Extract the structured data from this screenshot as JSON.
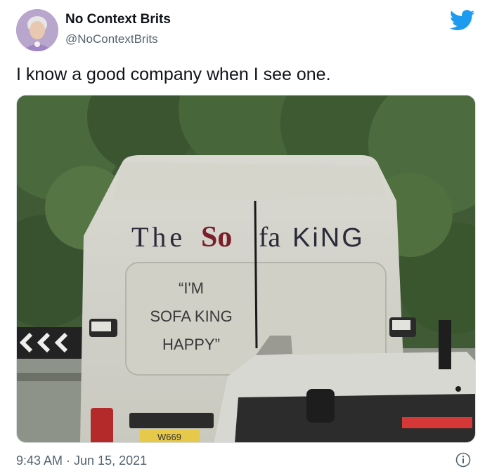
{
  "author": {
    "name": "No Context Brits",
    "handle": "@NoContextBrits"
  },
  "tweet": {
    "text": "I know a good company when I see one.",
    "timestamp": "9:43 AM · Jun 15, 2021"
  },
  "photo": {
    "van_brand_part1": "The",
    "van_brand_part2": "So",
    "van_brand_part3": "fa",
    "van_brand_part4": "KiNG",
    "slogan_line1": "“I'M",
    "slogan_line2": "SOFA KING",
    "slogan_line3": "HAPPY”",
    "plate": "W669"
  },
  "colors": {
    "twitter_blue": "#1d9bf0",
    "text_primary": "#0f1419",
    "text_secondary": "#536471"
  },
  "icons": [
    "bird-icon",
    "info-icon"
  ]
}
